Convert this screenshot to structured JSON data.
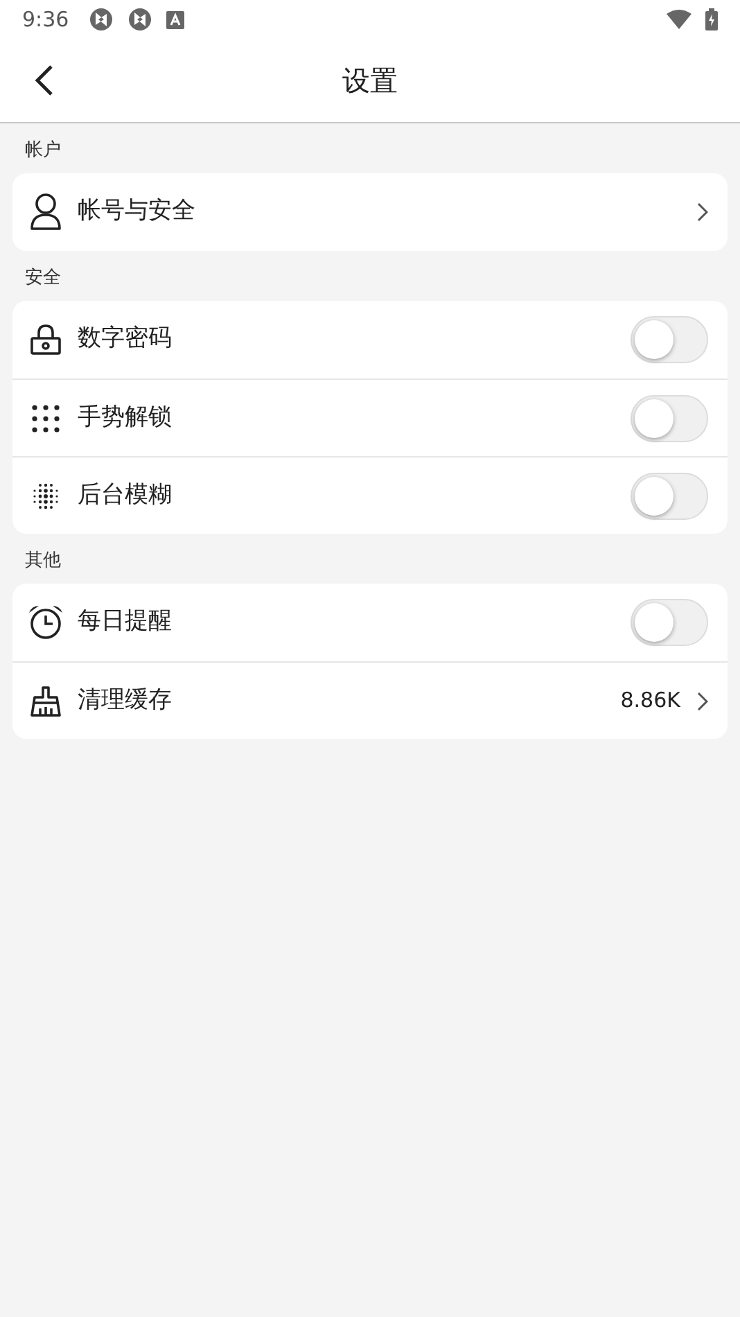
{
  "status_bar": {
    "time": "9:36"
  },
  "header": {
    "title": "设置"
  },
  "sections": [
    {
      "title": "帐户",
      "rows": [
        {
          "kind": "link",
          "label": "帐号与安全"
        }
      ]
    },
    {
      "title": "安全",
      "rows": [
        {
          "kind": "toggle",
          "label": "数字密码",
          "on": false
        },
        {
          "kind": "toggle",
          "label": "手势解锁",
          "on": false
        },
        {
          "kind": "toggle",
          "label": "后台模糊",
          "on": false
        }
      ]
    },
    {
      "title": "其他",
      "rows": [
        {
          "kind": "toggle",
          "label": "每日提醒",
          "on": false
        },
        {
          "kind": "link",
          "label": "清理缓存",
          "value": "8.86K"
        }
      ]
    }
  ]
}
